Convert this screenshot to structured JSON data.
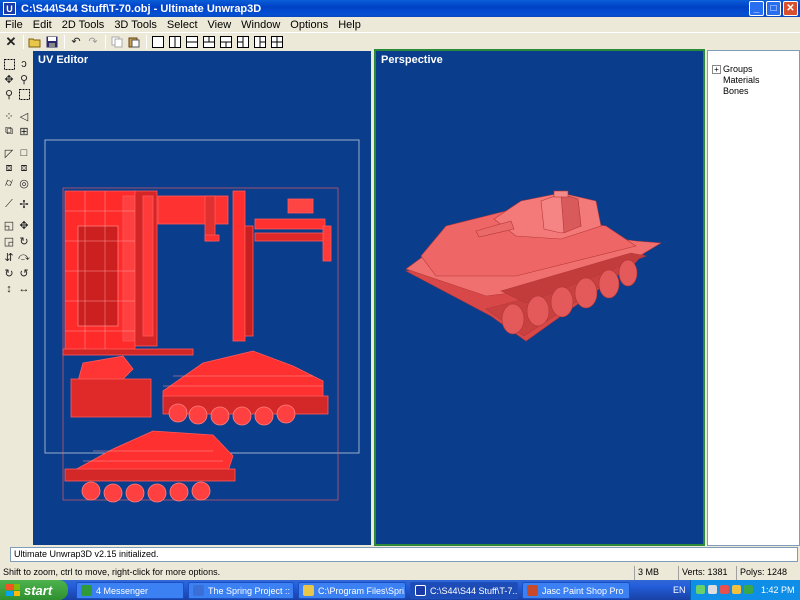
{
  "window": {
    "title": "C:\\S44\\S44 Stuff\\T-70.obj - Ultimate Unwrap3D",
    "app_icon_letter": "U",
    "buttons": {
      "minimize": "_",
      "maximize": "□",
      "close": "✕"
    }
  },
  "menu": [
    "File",
    "Edit",
    "2D Tools",
    "3D Tools",
    "Select",
    "View",
    "Window",
    "Options",
    "Help"
  ],
  "toolbar": {
    "icons": [
      "close-doc-icon",
      "open-icon",
      "save-icon",
      "undo-icon",
      "redo-icon",
      "copy-icon",
      "paste-icon",
      "layout-single-icon",
      "layout-split-vertical-icon",
      "layout-split-horizontal-icon",
      "layout-three-a-icon",
      "layout-three-b-icon",
      "layout-three-c-icon",
      "layout-three-d-icon",
      "layout-quad-icon"
    ]
  },
  "viewports": {
    "uv": {
      "label": "UV Editor"
    },
    "perspective": {
      "label": "Perspective"
    }
  },
  "tree": {
    "expander": "+",
    "items": [
      "Groups",
      "Materials",
      "Bones"
    ]
  },
  "log": {
    "message": "Ultimate Unwrap3D  v2.15 initialized."
  },
  "status": {
    "hint": "Shift to zoom, ctrl to move, right-click for more options.",
    "memory": "3 MB",
    "verts": "Verts: 1381",
    "polys": "Polys: 1248"
  },
  "taskbar": {
    "start_label": "start",
    "tasks": [
      {
        "label": "4 Messenger",
        "icon_color": "#2e9a3a",
        "active": false
      },
      {
        "label": "The Spring Project :: ...",
        "icon_color": "#3a6fd8",
        "active": false
      },
      {
        "label": "C:\\Program Files\\Spri...",
        "icon_color": "#e8c64a",
        "active": false
      },
      {
        "label": "C:\\S44\\S44 Stuff\\T-7...",
        "icon_color": "#1a3aa8",
        "active": true
      },
      {
        "label": "Jasc Paint Shop Pro",
        "icon_color": "#c84a2a",
        "active": false
      }
    ],
    "language": "EN",
    "clock": "1:42 PM"
  },
  "colors": {
    "viewport_bg": "#0a3d8c",
    "mesh_red": "#ff3b3b",
    "model_fill": "#e85a5a",
    "active_border": "#2a8a3a"
  }
}
